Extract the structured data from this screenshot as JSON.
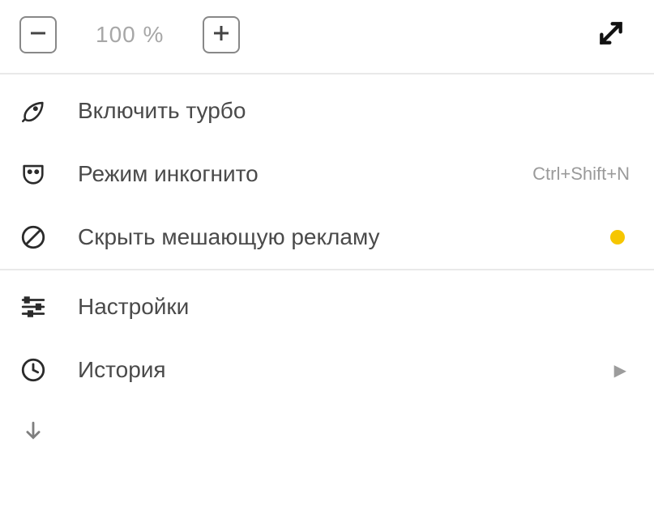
{
  "zoom": {
    "level": "100 %"
  },
  "items": {
    "turbo": {
      "label": "Включить турбо"
    },
    "incognito": {
      "label": "Режим инкогнито",
      "shortcut": "Ctrl+Shift+N"
    },
    "ads": {
      "label": "Скрыть мешающую рекламу"
    },
    "settings": {
      "label": "Настройки"
    },
    "history": {
      "label": "История"
    }
  }
}
